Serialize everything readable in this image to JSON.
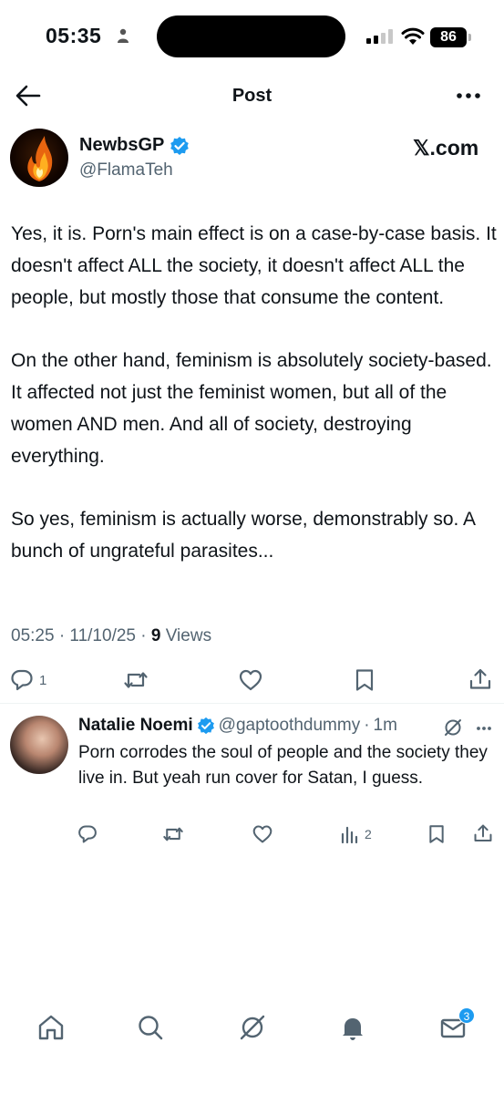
{
  "status_bar": {
    "time": "05:35",
    "battery": "86"
  },
  "header": {
    "title": "Post"
  },
  "post": {
    "author_name": "NewbsGP",
    "author_handle": "@FlamaTeh",
    "source_label": "𝕏.com",
    "body": "Yes, it is. Porn's main effect is on a case-by-case basis. It doesn't affect ALL the society, it doesn't affect ALL the people, but mostly those that consume the content.\n\nOn the other hand, feminism is absolutely society-based. It affected not just the feminist women, but all of the women AND men. And all of society, destroying everything.\n\nSo yes, feminism is actually worse, demonstrably so. A bunch of ungrateful parasites...",
    "timestamp": "05:25 · 11/10/25 · ",
    "views_count": "9",
    "views_label": " Views",
    "reply_count": "1"
  },
  "reply": {
    "author_name": "Natalie Noemi",
    "author_handle": "@gaptoothdummy",
    "separator": "·",
    "time": "1m",
    "body": "Porn corrodes the soul of people and the society they live in. But yeah run cover for Satan, I guess.",
    "views_count": "2"
  },
  "nav": {
    "messages_badge": "3"
  },
  "colors": {
    "verified": "#1d9bf0",
    "secondary_text": "#536471",
    "icon": "#536471"
  },
  "icons": [
    "back-arrow-icon",
    "more-icon",
    "verified-icon",
    "reply-icon",
    "retweet-icon",
    "like-icon",
    "bookmark-icon",
    "share-icon",
    "grok-icon",
    "views-icon",
    "home-icon",
    "search-icon",
    "bell-icon",
    "mail-icon"
  ]
}
